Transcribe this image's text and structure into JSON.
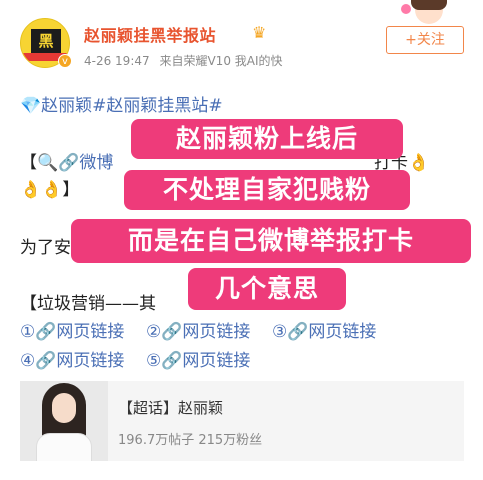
{
  "header": {
    "username": "赵丽颖挂黑举报站",
    "crown_icon": "crown-icon",
    "avatar_text": "黑",
    "verified_mark": "v",
    "timestamp": "4-26 19:47",
    "source": "来自荣耀V10 我AI的快",
    "follow_label": "+关注"
  },
  "post": {
    "topic_line": "💎赵丽颖#赵丽颖挂黑站#",
    "line1_prefix": "【🔍",
    "line1_link": "🔗微博",
    "line1_tail": "打卡👌",
    "line2": "👌👌】",
    "line3": "为了安",
    "line4": "【垃圾营销——其",
    "links_row1": [
      "①🔗网页链接",
      "②🔗网页链接",
      "③🔗网页链接"
    ],
    "links_row2": [
      "④🔗网页链接",
      "⑤🔗网页链接"
    ]
  },
  "overlays": {
    "caption1": "赵丽颖粉上线后",
    "caption2": "不处理自家犯贱粉",
    "caption3": "而是在自己微博举报打卡",
    "caption4": "几个意思"
  },
  "card": {
    "title": "【超话】赵丽颖",
    "stats": "196.7万帖子 215万粉丝"
  },
  "colors": {
    "username": "#e8542f",
    "link": "#4a6fb5",
    "overlay": "#ee3b7a",
    "follow": "#f2864a"
  }
}
